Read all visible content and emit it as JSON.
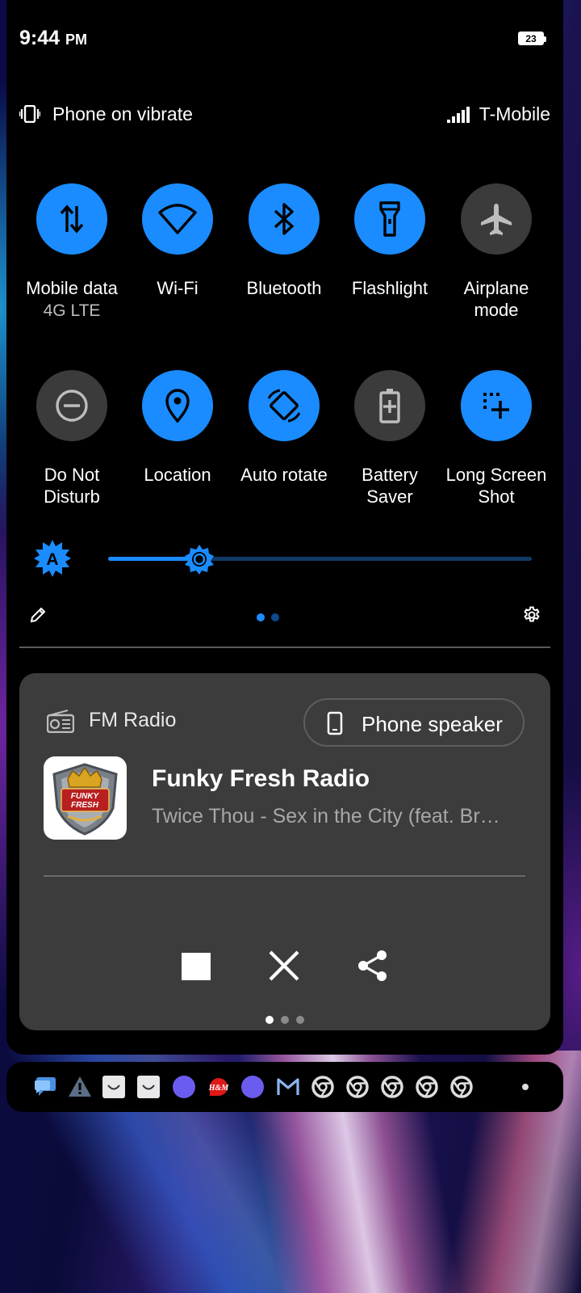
{
  "status_bar": {
    "time": "9:44",
    "ampm": "PM",
    "battery": "23"
  },
  "header": {
    "ringer": "Phone on vibrate",
    "carrier": "T-Mobile"
  },
  "tiles": [
    {
      "label": "Mobile data",
      "sub": "4G LTE",
      "state": "on",
      "icon": "swap-vert-icon"
    },
    {
      "label": "Wi-Fi",
      "sub": "",
      "state": "on",
      "icon": "wifi-icon"
    },
    {
      "label": "Bluetooth",
      "sub": "",
      "state": "on",
      "icon": "bluetooth-icon"
    },
    {
      "label": "Flashlight",
      "sub": "",
      "state": "on",
      "icon": "flashlight-icon"
    },
    {
      "label": "Airplane mode",
      "sub": "",
      "state": "off",
      "icon": "airplane-icon"
    },
    {
      "label": "Do Not Disturb",
      "sub": "",
      "state": "off",
      "icon": "do-not-disturb-icon"
    },
    {
      "label": "Location",
      "sub": "",
      "state": "on",
      "icon": "location-pin-icon"
    },
    {
      "label": "Auto rotate",
      "sub": "",
      "state": "on",
      "icon": "auto-rotate-icon"
    },
    {
      "label": "Battery Saver",
      "sub": "",
      "state": "off",
      "icon": "battery-saver-icon"
    },
    {
      "label": "Long Screen Shot",
      "sub": "",
      "state": "on",
      "icon": "long-screenshot-icon"
    }
  ],
  "brightness": {
    "level": 0.12,
    "auto_badge": "A"
  },
  "quick_settings_page": {
    "current": 1,
    "total": 2
  },
  "media": {
    "app_name": "FM Radio",
    "output_label": "Phone speaker",
    "title": "Funky Fresh Radio",
    "artist": "Twice Thou - Sex in the City (feat. Br…",
    "album_art_text": "FUNKY FRESH",
    "controls": [
      "stop-icon",
      "close-icon",
      "share-icon"
    ],
    "page": {
      "current": 1,
      "total": 3
    }
  },
  "colors": {
    "accent": "#1a8cff",
    "tile_off": "#3b3b3b",
    "card": "#3c3c3c"
  },
  "notification_icons": [
    "messages-icon",
    "warning-icon",
    "shopping-bag-icon",
    "shopping-bag-icon",
    "circle-app-icon",
    "hm-icon",
    "circle-app-icon",
    "gmail-icon",
    "chrome-icon",
    "chrome-icon",
    "chrome-icon",
    "chrome-icon",
    "chrome-icon",
    "more-dot-icon"
  ]
}
